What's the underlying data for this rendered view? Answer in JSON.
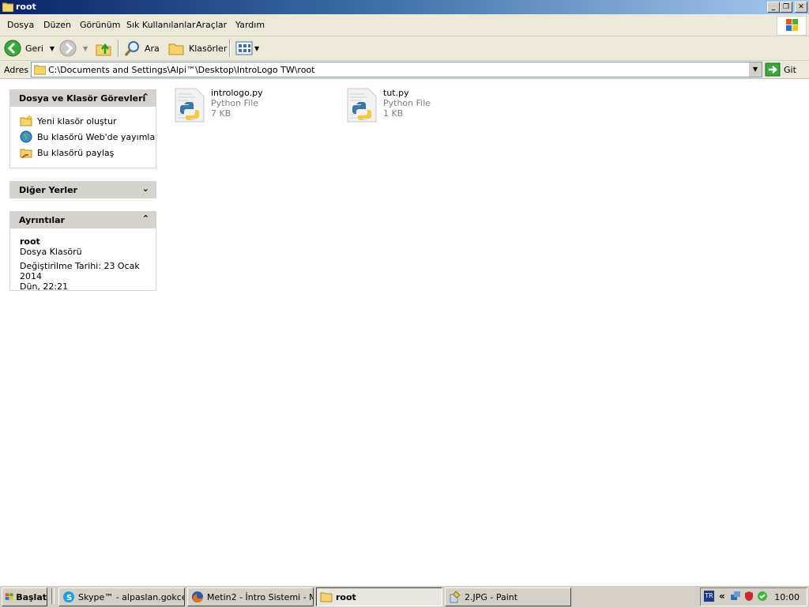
{
  "window": {
    "title": "root"
  },
  "menu": [
    "Dosya",
    "Düzen",
    "Görünüm",
    "Sık Kullanılanlar",
    "Araçlar",
    "Yardım"
  ],
  "toolbar": {
    "back": "Geri",
    "search": "Ara",
    "folders": "Klasörler"
  },
  "address": {
    "label": "Adres",
    "path": "C:\\Documents and Settings\\Alpi™\\Desktop\\IntroLogo TW\\root",
    "go": "Git"
  },
  "tasks_panel": {
    "title": "Dosya ve Klasör Görevleri",
    "items": [
      "Yeni klasör oluştur",
      "Bu klasörü Web'de yayımla",
      "Bu klasörü paylaş"
    ]
  },
  "other_places": {
    "title": "Diğer Yerler"
  },
  "details": {
    "title": "Ayrıntılar",
    "name": "root",
    "type": "Dosya Klasörü",
    "modified_line1": "Değiştirilme Tarihi: 23 Ocak 2014",
    "modified_line2": "Dün, 22:21"
  },
  "files": [
    {
      "name": "intrologo.py",
      "type": "Python File",
      "size": "7 KB"
    },
    {
      "name": "tut.py",
      "type": "Python File",
      "size": "1 KB"
    }
  ],
  "taskbar": {
    "start": "Başlat",
    "buttons": [
      {
        "label": "Skype™ - alpaslan.gokce..."
      },
      {
        "label": "Metin2 - İntro Sistemi - M..."
      },
      {
        "label": "root"
      },
      {
        "label": "2.JPG - Paint"
      }
    ],
    "lang": "TR",
    "clock": "10:00"
  },
  "colors": {
    "titlebar": "#0a246a",
    "panel_header": "#d6d3ce",
    "chrome": "#ece9d8"
  }
}
